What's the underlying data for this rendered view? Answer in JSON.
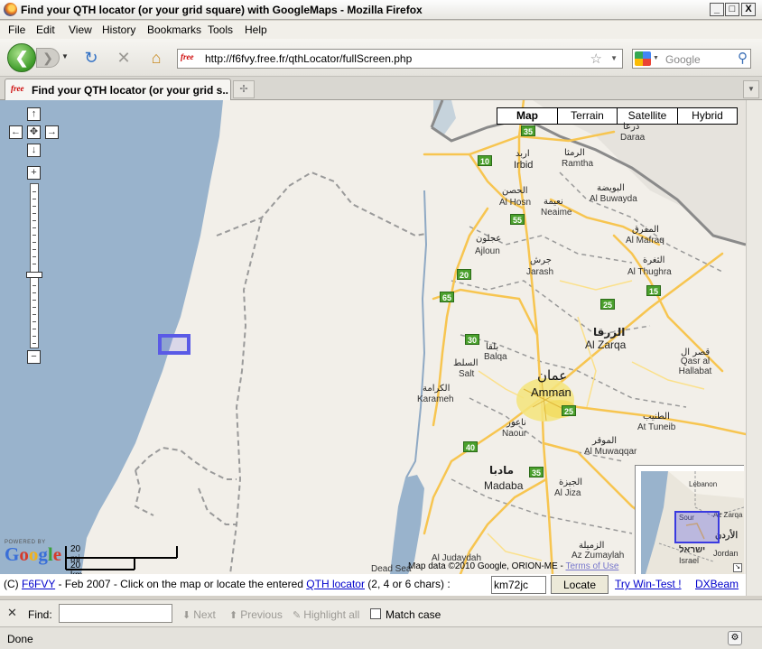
{
  "window": {
    "title": "Find your QTH locator (or your grid square) with GoogleMaps - Mozilla Firefox",
    "controls": [
      "_",
      "□",
      "X"
    ]
  },
  "menu": [
    "File",
    "Edit",
    "View",
    "History",
    "Bookmarks",
    "Tools",
    "Help"
  ],
  "navbar": {
    "url": "http://f6fvy.free.fr/qthLocator/fullScreen.php",
    "site_badge": "free",
    "search_placeholder": "Google"
  },
  "tab": {
    "badge": "free",
    "title": "Find your QTH locator (or your grid s..."
  },
  "map": {
    "types": [
      "Map",
      "Terrain",
      "Satellite",
      "Hybrid"
    ],
    "selected_type": "Map",
    "pan": {
      "up": "↑",
      "left": "←",
      "center": "✥",
      "right": "→",
      "down": "↓"
    },
    "zoom_in": "+",
    "zoom_out": "−",
    "labels": {
      "irbid_ar": "اربد",
      "irbid": "Irbid",
      "ramtha_ar": "الرمثا",
      "ramtha": "Ramtha",
      "daraa": "Daraa",
      "daraa_ar": "درعا",
      "alhosn_ar": "الحصن",
      "alhosn": "Al Hosn",
      "neaime_ar": "نعيمة",
      "neaime": "Neaime",
      "buwayda_ar": "البويضة",
      "buwayda": "Al Buwayda",
      "ajloun_ar": "عجلون",
      "ajloun": "Ajloun",
      "mafraq_ar": "المفرق",
      "mafraq": "Al Mafraq",
      "jarash_ar": "جرش",
      "jarash": "Jarash",
      "thughra_ar": "الثغرة",
      "thughra": "Al Thughra",
      "zarqa_ar": "الزرقا",
      "zarqa": "Al Zarqa",
      "balqa_ar": "بلقا",
      "balqa": "Balqa",
      "salt_ar": "السلط",
      "salt": "Salt",
      "qasr_ar": "قصر ال",
      "qasr": "Qasr al Hallabat",
      "karameh_ar": "الكرامة",
      "karameh": "Karameh",
      "amman_ar": "عمان",
      "amman": "Amman",
      "naour_ar": "ناعور",
      "naour": "Naour",
      "tuneib_ar": "الطنيب",
      "tuneib": "At Tuneib",
      "muwaqqar_ar": "الموقر",
      "muwaqqar": "Al Muwaqqar",
      "madaba_ar": "مادبا",
      "madaba": "Madaba",
      "jiza_ar": "الجيزة",
      "jiza": "Al Jiza",
      "zumaylah_ar": "الزميلة",
      "zumaylah": "Az Zumaylah",
      "judaydah": "Al Judaydah",
      "deadsea": "Dead Sea"
    },
    "shields": {
      "s35a": "35",
      "s10": "10",
      "s55": "55",
      "s20": "20",
      "s65": "65",
      "s25a": "25",
      "s15": "15",
      "s30": "30",
      "s25b": "25",
      "s40": "40",
      "s35b": "35"
    },
    "scale": {
      "mi": "20 mi",
      "km": "20 km"
    },
    "logo": {
      "powered": "POWERED BY",
      "name": "Google"
    },
    "attribution": "Map data ©2010 Google, ORION-ME - ",
    "terms": "Terms of Use",
    "overview": {
      "lebanon": "Lebanon",
      "zarqa": "Az Zarqa",
      "sour": "Sour",
      "jordan_ar": "الأردن",
      "israel_ar": "ישראל",
      "jordan": "Jordan",
      "israel": "Israel",
      "expand": "↘"
    }
  },
  "pageline": {
    "prefix": "(C) ",
    "author": "F6FVY",
    "middle": " - Feb 2007 - Click on the map or locate the entered ",
    "qth_link": "QTH locator",
    "suffix": " (2, 4 or 6 chars) :",
    "locator_value": "km72jc",
    "locate_button": "Locate",
    "wintest_link": "Try Win-Test !",
    "dxbeam_link": "DXBeam"
  },
  "findbar": {
    "close": "✕",
    "label": "Find:",
    "value": "",
    "next": "Next",
    "previous": "Previous",
    "highlight": "Highlight all",
    "match_case": "Match case"
  },
  "status": {
    "text": "Done"
  },
  "colors": {
    "sea": "#99b3cc",
    "land": "#f2efe9",
    "road": "#f7c550",
    "border": "#999999",
    "city": "#f5e47a",
    "route_shield": "#4aa02c"
  }
}
